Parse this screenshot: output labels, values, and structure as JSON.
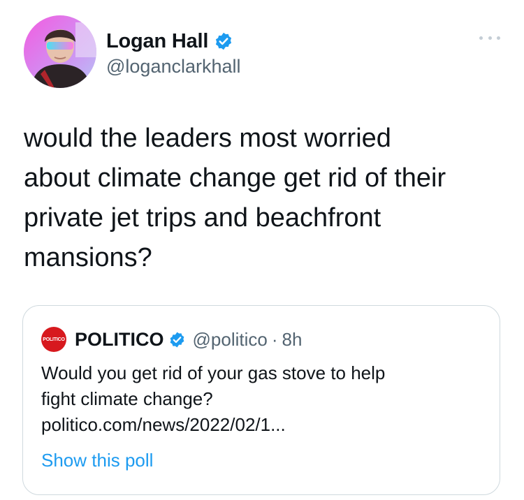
{
  "author": {
    "display_name": "Logan Hall",
    "handle": "@loganclarkhall",
    "verified_icon": "verified-badge-icon"
  },
  "tweet": {
    "text_lines": [
      "would the leaders most worried",
      "about climate change get rid of their",
      "private jet trips and beachfront",
      "mansions?"
    ]
  },
  "quoted_tweet": {
    "avatar_text": "POLITICO",
    "display_name": "POLITICO",
    "handle": "@politico",
    "separator": "·",
    "time": "8h",
    "text_lines": [
      "Would you get rid of your gas stove to help",
      "fight climate change?",
      "politico.com/news/2022/02/1..."
    ],
    "poll_link": "Show this poll"
  },
  "colors": {
    "accent": "#1d9bf0",
    "text": "#0f1419",
    "secondary": "#536471",
    "border": "#cfd9de",
    "politico_red": "#d7191e"
  }
}
